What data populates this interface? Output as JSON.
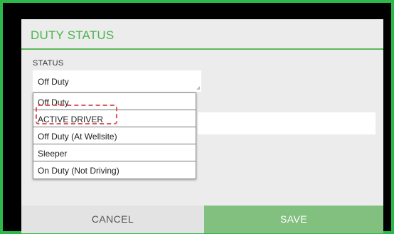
{
  "dialog": {
    "title": "DUTY STATUS",
    "status_label": "STATUS",
    "selected_value": "Off Duty",
    "options": [
      "Off Duty",
      "ACTIVE DRIVER",
      "Off Duty (At Wellsite)",
      "Sleeper",
      "On Duty (Not Driving)"
    ],
    "cancel_label": "CANCEL",
    "save_label": "SAVE"
  },
  "colors": {
    "frame_border": "#2fb84a",
    "title": "#4bb54f",
    "save_button": "#82c07f",
    "highlight": "#e0595e"
  }
}
